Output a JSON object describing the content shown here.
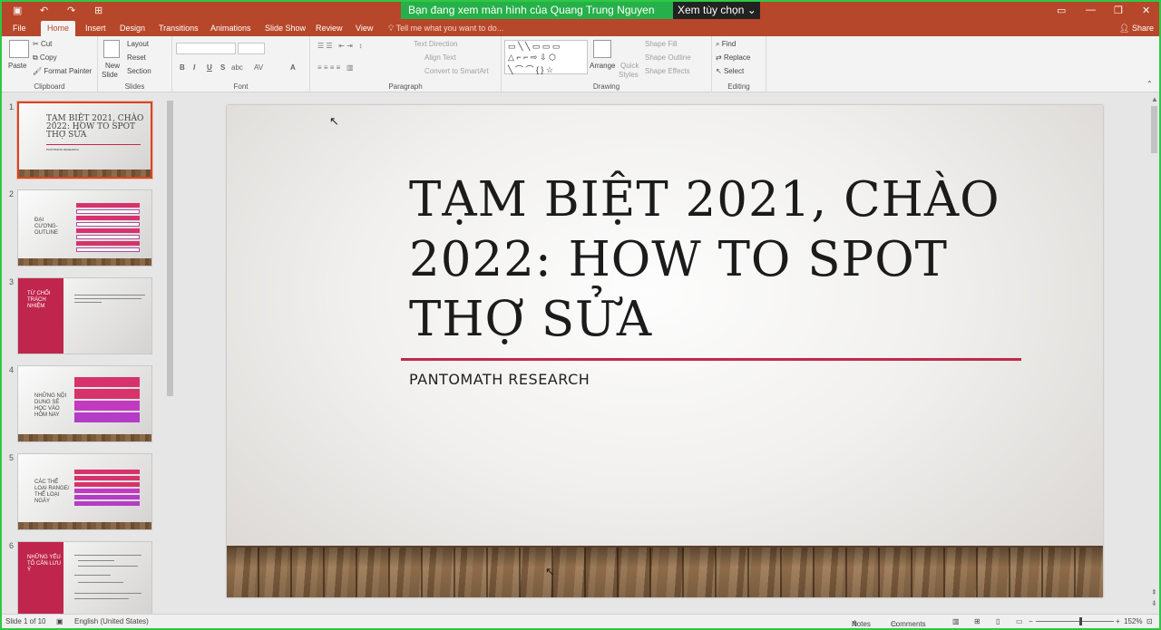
{
  "titlebar": {
    "save_icon": "save-icon",
    "undo_icon": "undo-icon",
    "redo_icon": "redo-icon",
    "present_icon": "present-icon",
    "share_banner": "Bạn đang xem màn hình của Quang Trung Nguyen",
    "view_options": "Xem tùy chọn",
    "win_controls": [
      "▭",
      "—",
      "❐",
      "✕"
    ]
  },
  "tabs": [
    "File",
    "Home",
    "Insert",
    "Design",
    "Transitions",
    "Animations",
    "Slide Show",
    "Review",
    "View"
  ],
  "active_tab": "Home",
  "tell_me": "Tell me what you want to do...",
  "share": "Share",
  "ribbon": {
    "clipboard": {
      "paste": "Paste",
      "cut": "Cut",
      "copy": "Copy",
      "format_painter": "Format Painter",
      "label": "Clipboard"
    },
    "slides": {
      "new_slide": "New",
      "new_slide2": "Slide",
      "layout": "Layout",
      "reset": "Reset",
      "section": "Section",
      "label": "Slides"
    },
    "font": {
      "bold": "B",
      "italic": "I",
      "underline": "U",
      "strike": "S",
      "spacing": "abc",
      "case": "AV",
      "color": "A",
      "label": "Font"
    },
    "paragraph": {
      "text_direction": "Text Direction",
      "align_text": "Align Text",
      "convert_smartart": "Convert to SmartArt",
      "label": "Paragraph"
    },
    "drawing": {
      "arrange": "Arrange",
      "quick_styles": "Quick",
      "quick_styles2": "Styles",
      "shape_fill": "Shape Fill",
      "shape_outline": "Shape Outline",
      "shape_effects": "Shape Effects",
      "label": "Drawing"
    },
    "editing": {
      "find": "Find",
      "replace": "Replace",
      "select": "Select",
      "label": "Editing"
    }
  },
  "slides": [
    {
      "num": "1",
      "title": "TẠM BIỆT 2021, CHÀO 2022: HOW TO SPOT THỢ SỬA",
      "subtitle": "PANTOMATH RESEARCH"
    },
    {
      "num": "2",
      "title": "ĐẠI CƯƠNG- OUTLINE"
    },
    {
      "num": "3",
      "title": "TỪ CHỐI TRÁCH NHIỆM"
    },
    {
      "num": "4",
      "title": "NHỮNG NỘI DUNG SẼ HỌC VÀO HÔM NAY"
    },
    {
      "num": "5",
      "title": "CÁC THỂ LOẠI RANGE/ THỂ LOẠI NGÀY"
    },
    {
      "num": "6",
      "title": "NHỮNG YẾU TỐ CẦN LƯU Ý"
    }
  ],
  "current_slide": {
    "title": "TẠM BIỆT 2021, CHÀO 2022: HOW TO SPOT THỢ SỬA",
    "subtitle": "PANTOMATH RESEARCH"
  },
  "status": {
    "slide_count": "Slide 1 of 10",
    "language": "English (United States)",
    "notes": "Notes",
    "comments": "Comments",
    "zoom": "152%"
  }
}
